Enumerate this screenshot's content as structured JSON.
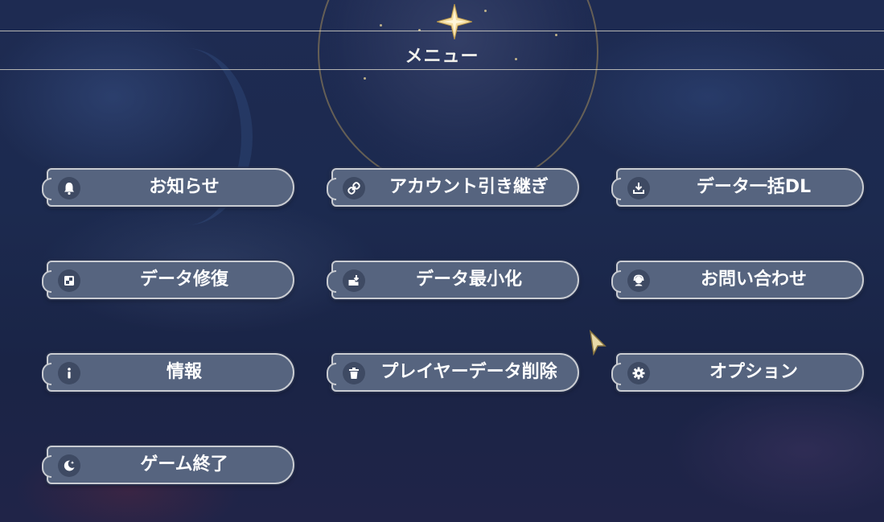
{
  "header": {
    "title": "メニュー"
  },
  "menu": {
    "items": [
      {
        "label": "お知らせ",
        "icon": "bell-icon"
      },
      {
        "label": "アカウント引き継ぎ",
        "icon": "link-icon"
      },
      {
        "label": "データ一括DL",
        "icon": "download-icon"
      },
      {
        "label": "データ修復",
        "icon": "repair-icon"
      },
      {
        "label": "データ最小化",
        "icon": "minimize-icon"
      },
      {
        "label": "お問い合わせ",
        "icon": "support-icon"
      },
      {
        "label": "情報",
        "icon": "info-icon"
      },
      {
        "label": "プレイヤーデータ削除",
        "icon": "trash-icon"
      },
      {
        "label": "オプション",
        "icon": "gear-icon"
      },
      {
        "label": "ゲーム終了",
        "icon": "moon-icon"
      }
    ]
  },
  "colors": {
    "button_fill": "#56647f",
    "button_border": "#c9ccd2",
    "accent_gold": "#d8b86a",
    "text": "#ffffff"
  }
}
